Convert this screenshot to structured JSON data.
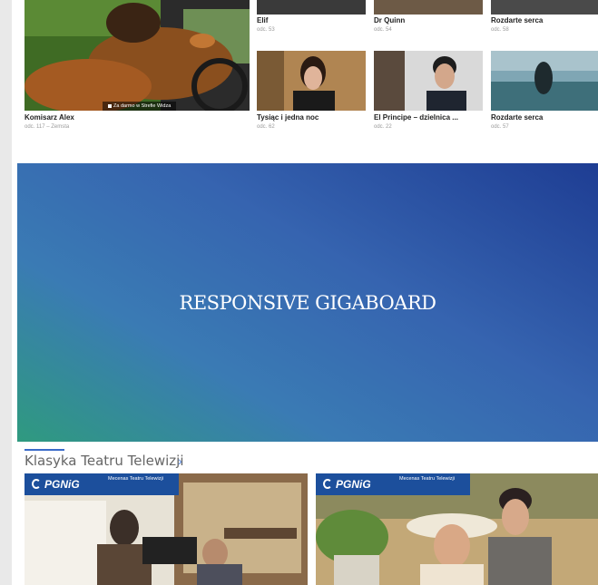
{
  "featured": {
    "title": "Komisarz Alex",
    "subtitle": "odc. 117 – Zemsta",
    "badge": "Za darmo w Strefie Widza"
  },
  "cards": [
    {
      "title": "Elif",
      "subtitle": "odc. 53"
    },
    {
      "title": "Dr Quinn",
      "subtitle": "odc. 54"
    },
    {
      "title": "Rozdarte serca",
      "subtitle": "odc. 58"
    },
    {
      "title": "Tysiąc i jedna noc",
      "subtitle": "odc. 62"
    },
    {
      "title": "El Principe – dzielnica ...",
      "subtitle": "odc. 22"
    },
    {
      "title": "Rozdarte serca",
      "subtitle": "odc. 57"
    }
  ],
  "gigaboard": {
    "label": "RESPONSIVE GIGABOARD"
  },
  "section": {
    "title": "Klasyka Teatru Telewizji",
    "chevron": "›"
  },
  "tiles": [
    {
      "brand": "PGNiG",
      "tagline": "Mecenas Teatru Telewizji"
    },
    {
      "brand": "PGNiG",
      "tagline": "Mecenas Teatru Telewizji"
    }
  ],
  "colors": {
    "accent": "#3a6bc9",
    "brand": "#1c4f9c"
  }
}
